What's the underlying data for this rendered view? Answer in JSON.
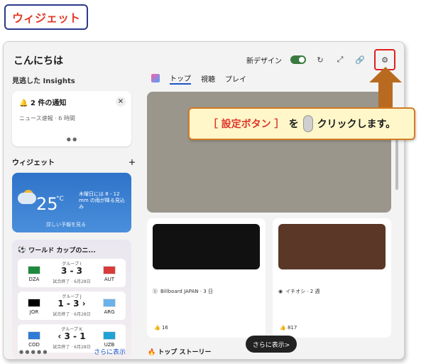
{
  "badge": {
    "title": "ウィジェット"
  },
  "panel": {
    "greeting": "こんにちは",
    "new_design_label": "新デザイン",
    "sections": {
      "insights": "見逃した Insights",
      "widgets": "ウィジェット"
    },
    "notification": {
      "title": "2 件の通知",
      "subtitle": "ニュース速報 · 6 時間"
    },
    "weather": {
      "temp": "25",
      "unit": "°C",
      "desc": "木曜日には 8 - 12 mm の雨が降る見込み",
      "link": "詳しい予報を見る"
    },
    "worldcup": {
      "title": "ワールド カップのニ...",
      "matches": [
        {
          "group": "グループ I",
          "left": "DZA",
          "right": "AUT",
          "score": "3 - 3",
          "meta": "試合終了 · 6月28日"
        },
        {
          "group": "グループ J",
          "left": "JOR",
          "right": "ARG",
          "score": "1 - 3 ›",
          "meta": "試合終了 · 6月28日"
        },
        {
          "group": "グループ K",
          "left": "COD",
          "right": "UZB",
          "score": "‹ 3 - 1",
          "meta": "試合終了 · 6月28日"
        }
      ],
      "show_more": "さらに表示"
    },
    "tabs": [
      "トップ",
      "視聴",
      "プレイ"
    ],
    "cards": [
      {
        "source": "Billboard JAPAN · 3 日",
        "likes": "16",
        "thumb_color": "#111111"
      },
      {
        "source": "イチオシ · 2 週",
        "likes": "817",
        "thumb_color": "#5a3726"
      }
    ],
    "top_story": "トップ ストーリー",
    "more_button": "さらに表示>"
  },
  "callout": {
    "part1": "［ 設定ボタン ］",
    "part2": "を",
    "part3": "クリックします。"
  }
}
